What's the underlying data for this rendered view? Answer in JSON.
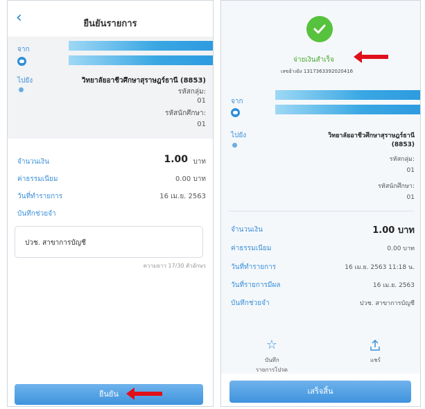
{
  "left": {
    "title": "ยืนยันรายการ",
    "from_label": "จาก",
    "to_label": "ไปยัง",
    "to_name": "วิทยาลัยอาชีวศึกษาสุราษฎร์ธานี (8853)",
    "group_label": "รหัสกลุ่ม:",
    "group_value": "01",
    "student_label": "รหัสนักศึกษา:",
    "student_value": "01",
    "amount_label": "จำนวนเงิน",
    "amount_value": "1.00",
    "amount_unit": "บาท",
    "fee_label": "ค่าธรรมเนียม",
    "fee_value": "0.00 บาท",
    "date_label": "วันที่ทำรายการ",
    "date_value": "16 เม.ย. 2563",
    "memo_label": "บันทึกช่วยจำ",
    "memo_value": "ปวช. สาขาการบัญชี",
    "char_count": "ความยาว 17/30 ตัวอักษร",
    "confirm_button": "ยืนยัน"
  },
  "right": {
    "status": "จ่ายเงินสำเร็จ",
    "ref": "เลขอ้างอิง 13173633920204​16",
    "from_label": "จาก",
    "to_label": "ไปยัง",
    "to_name": "วิทยาลัยอาชีวศึกษาสุราษฎร์ธานี",
    "to_code": "(8853)",
    "group_label": "รหัสกลุ่ม:",
    "group_value": "01",
    "student_label": "รหัสนักศึกษา:",
    "student_value": "01",
    "amount_label": "จำนวนเงิน",
    "amount_value": "1.00 บาท",
    "fee_label": "ค่าธรรมเนียม",
    "fee_value": "0.00 บาท",
    "date_label": "วันที่ทำรายการ",
    "date_value": "16 เม.ย. 2563 11:18 น.",
    "effective_label": "วันที่รายการมีผล",
    "effective_value": "16 เม.ย. 2563",
    "memo_label": "บันทึกช่วยจำ",
    "memo_value": "ปวช. สาขาการบัญชี",
    "fav_label_1": "บันทึก",
    "fav_label_2": "รายการโปรด",
    "share_label": "แชร์",
    "done_button": "เสร็จสิ้น"
  },
  "colors": {
    "accent": "#3a8fd8",
    "success": "#57c23d",
    "arrow": "#e0101a"
  },
  "icons": [
    "back-icon",
    "check-icon",
    "star-icon",
    "share-icon"
  ]
}
